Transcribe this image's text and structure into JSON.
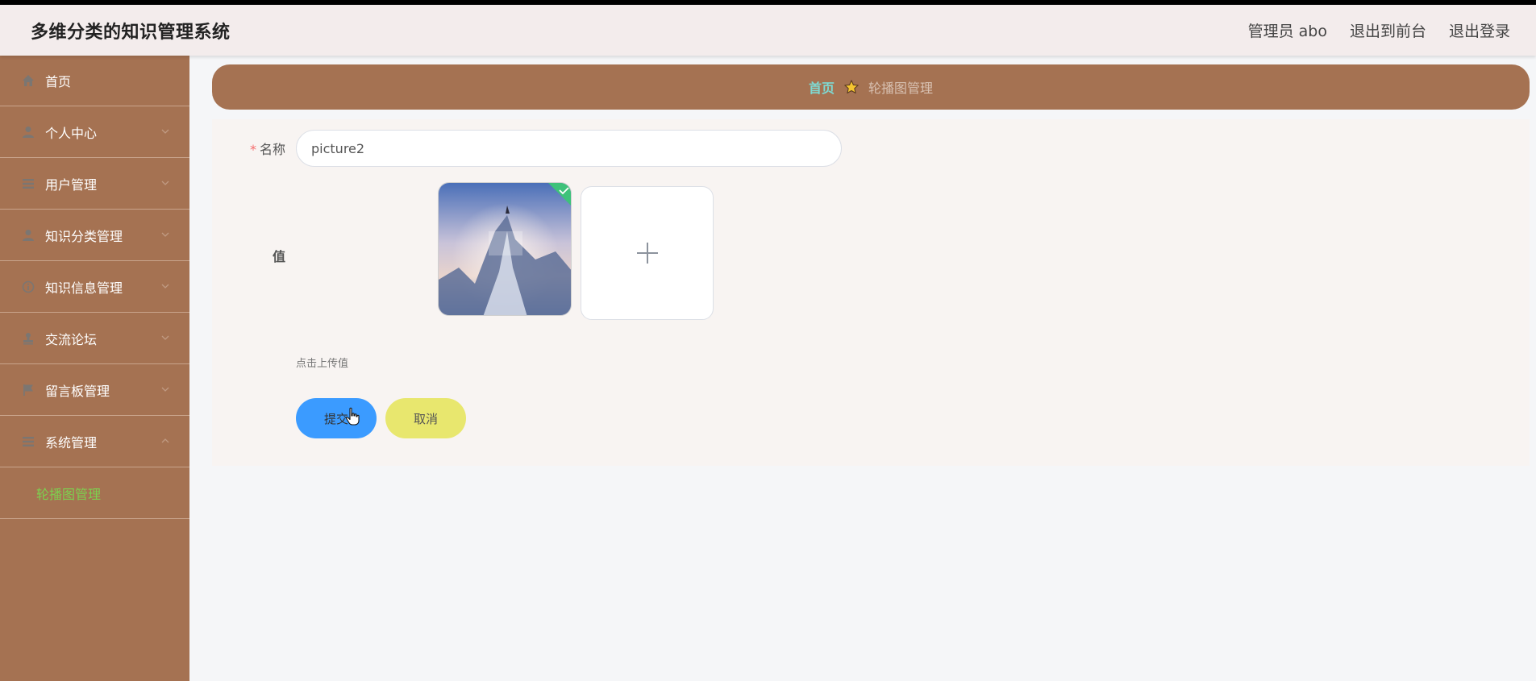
{
  "header": {
    "title": "多维分类的知识管理系统",
    "admin_label": "管理员 abo",
    "to_front": "退出到前台",
    "logout": "退出登录"
  },
  "sidebar": {
    "items": [
      {
        "label": "首页",
        "icon": "home-icon"
      },
      {
        "label": "个人中心",
        "icon": "user-icon"
      },
      {
        "label": "用户管理",
        "icon": "list-icon"
      },
      {
        "label": "知识分类管理",
        "icon": "user-icon"
      },
      {
        "label": "知识信息管理",
        "icon": "info-icon"
      },
      {
        "label": "交流论坛",
        "icon": "stamp-icon"
      },
      {
        "label": "留言板管理",
        "icon": "flag-icon"
      },
      {
        "label": "系统管理",
        "icon": "list-icon"
      }
    ],
    "submenu_active": "轮播图管理"
  },
  "breadcrumb": {
    "home": "首页",
    "current": "轮播图管理"
  },
  "form": {
    "name_label": "名称",
    "required_mark": "*",
    "name_value": "picture2",
    "value_label": "值",
    "upload_hint": "点击上传值",
    "submit_label": "提交",
    "cancel_label": "取消"
  },
  "colors": {
    "sidebar_bg": "#a57252",
    "active_submenu": "#7cd24f",
    "breadcrumb_home": "#7ed9d2",
    "submit_bg": "#3b9bff",
    "cancel_bg": "#e8e76e"
  }
}
